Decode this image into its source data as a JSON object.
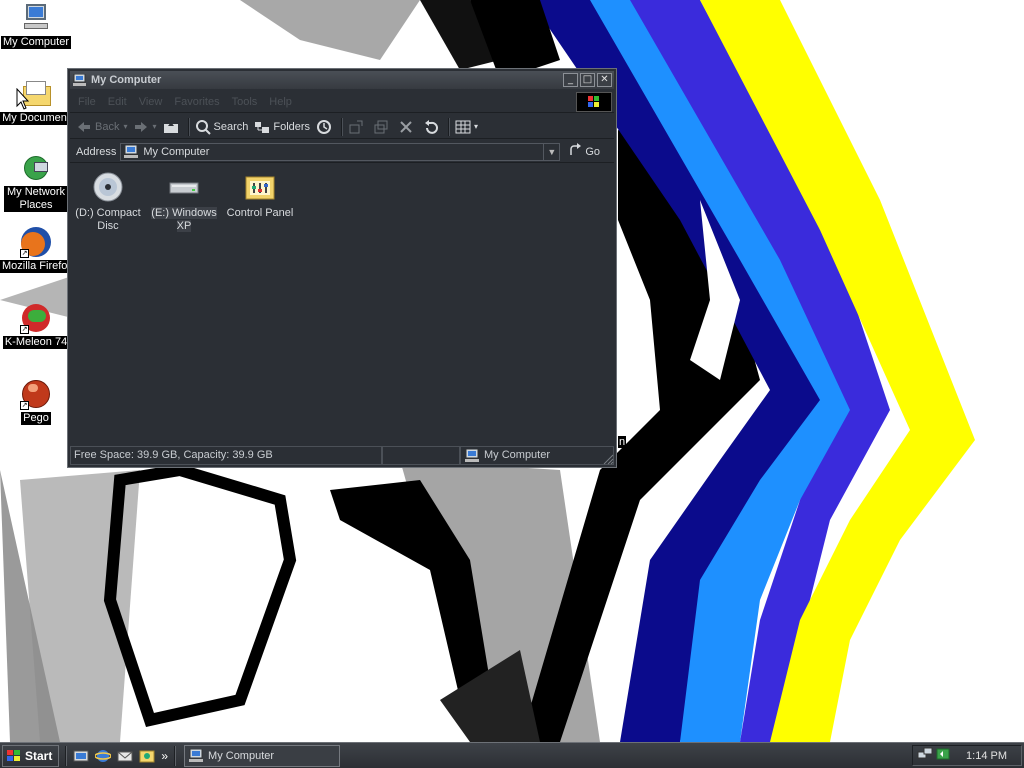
{
  "desktop": {
    "icons": [
      {
        "label": "My Computer",
        "icon": "my-computer-icon"
      },
      {
        "label": "My Document",
        "icon": "my-documents-folder-icon"
      },
      {
        "label": "My Network Places",
        "icon": "network-places-icon"
      },
      {
        "label": "Mozilla Firefo:",
        "icon": "firefox-icon"
      },
      {
        "label": "K-Meleon 74",
        "icon": "k-meleon-icon"
      },
      {
        "label": "Pego",
        "icon": "pego-icon"
      }
    ],
    "partial_text": "n"
  },
  "window": {
    "title": "My Computer",
    "menu": [
      "File",
      "Edit",
      "View",
      "Favorites",
      "Tools",
      "Help"
    ],
    "toolbar": {
      "back": "Back",
      "search": "Search",
      "folders": "Folders"
    },
    "address": {
      "label": "Address",
      "value": "My Computer",
      "go": "Go"
    },
    "items": [
      {
        "label": "(D:) Compact Disc",
        "icon": "compact-disc-icon"
      },
      {
        "label": "(E:) Windows XP",
        "icon": "hard-drive-icon"
      },
      {
        "label": "Control Panel",
        "icon": "control-panel-icon"
      }
    ],
    "status": {
      "free_space": "Free Space: 39.9 GB, Capacity: 39.9 GB",
      "location": "My Computer"
    }
  },
  "taskbar": {
    "start": "Start",
    "task": "My Computer",
    "clock": "1:14 PM",
    "chevron": "»"
  },
  "colors": {
    "window_bg": "#2b2f35",
    "title_bar": "#3e4248",
    "wallpaper_yellow": "#ffff00",
    "wallpaper_blue": "#1e90ff",
    "wallpaper_navy": "#0b0b8c"
  }
}
